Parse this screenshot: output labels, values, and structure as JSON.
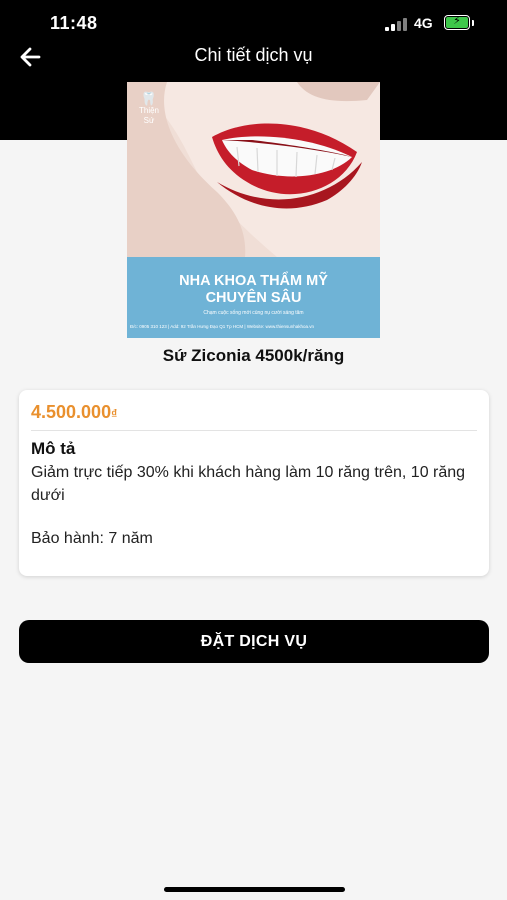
{
  "status_bar": {
    "time": "11:48",
    "network": "4G",
    "battery_icon": "battery-charging-icon",
    "signal_icon": "signal-icon"
  },
  "header": {
    "title": "Chi tiết dịch vụ",
    "back_icon": "arrow-left-icon"
  },
  "poster": {
    "brand": "Thiện Sứ",
    "heading_line1": "NHA KHOA THẨM MỸ",
    "heading_line2": "CHUYÊN SÂU",
    "tagline": "Chạm cuộc sống mới cùng nụ cười sáng tâm",
    "contact": "Đ/c: 0905 310 123 | Add: 92 Trần Hưng Đạo Q1 Tp HCM | Website: www.thiensunhakhoa.vn"
  },
  "service": {
    "name": "Sứ Ziconia 4500k/răng",
    "price": "4.500.000",
    "currency": "₫"
  },
  "description": {
    "label": "Mô tả",
    "text": "Giảm trực tiếp 30% khi khách hàng làm 10 răng trên, 10 răng dưới",
    "warranty": "Bảo hành: 7 năm"
  },
  "actions": {
    "book_label": "ĐẶT DỊCH VỤ"
  },
  "colors": {
    "header_bg": "#000000",
    "price": "#e9902e",
    "poster_band": "#6fb3d6",
    "battery": "#3ec74a",
    "button_bg": "#000000"
  }
}
